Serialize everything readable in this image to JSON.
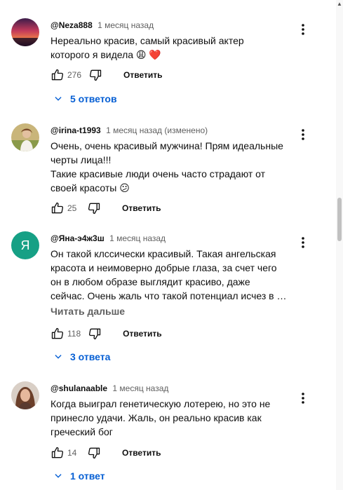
{
  "reply_label": "Ответить",
  "comments": [
    {
      "author": "@Neza888",
      "meta": "1 месяц назад",
      "lines": [
        "Нереально красив, самый красивый актер",
        "которого я видела 😩 ❤️"
      ],
      "likes": "276",
      "replies_label": "5 ответов",
      "avatar_icon": "sunset-photo-avatar"
    },
    {
      "author": "@irina-t1993",
      "meta": "1 месяц назад (изменено)",
      "lines": [
        "Очень, очень красивый мужчина! Прям идеальные",
        "черты лица!!!",
        "Такие красивые люди очень часто страдают от",
        "своей красоты 😕"
      ],
      "likes": "25",
      "avatar_icon": "girl-in-field-avatar"
    },
    {
      "author": "@Яна-э4ж3ш",
      "meta": "1 месяц назад",
      "avatar_letter": "Я",
      "lines": [
        "Он такой клссически красивый. Такая ангельская",
        "красота и неимоверно добрые глаза, за счет чего",
        "он в любом образе выглядит красиво, даже",
        "сейчас. Очень жаль что такой потенциал исчез в …"
      ],
      "read_more": "Читать дальше",
      "likes": "118",
      "replies_label": "3 ответа",
      "avatar_color": "#16a085"
    },
    {
      "author": "@shulanaable",
      "meta": "1 месяц назад",
      "lines": [
        "Когда выиграл генетическую лотерею, но это не",
        "принесло удачи. Жаль, он реально красив как",
        "греческий бог"
      ],
      "likes": "14",
      "replies_label": "1 ответ",
      "avatar_icon": "woman-portrait-avatar"
    }
  ]
}
